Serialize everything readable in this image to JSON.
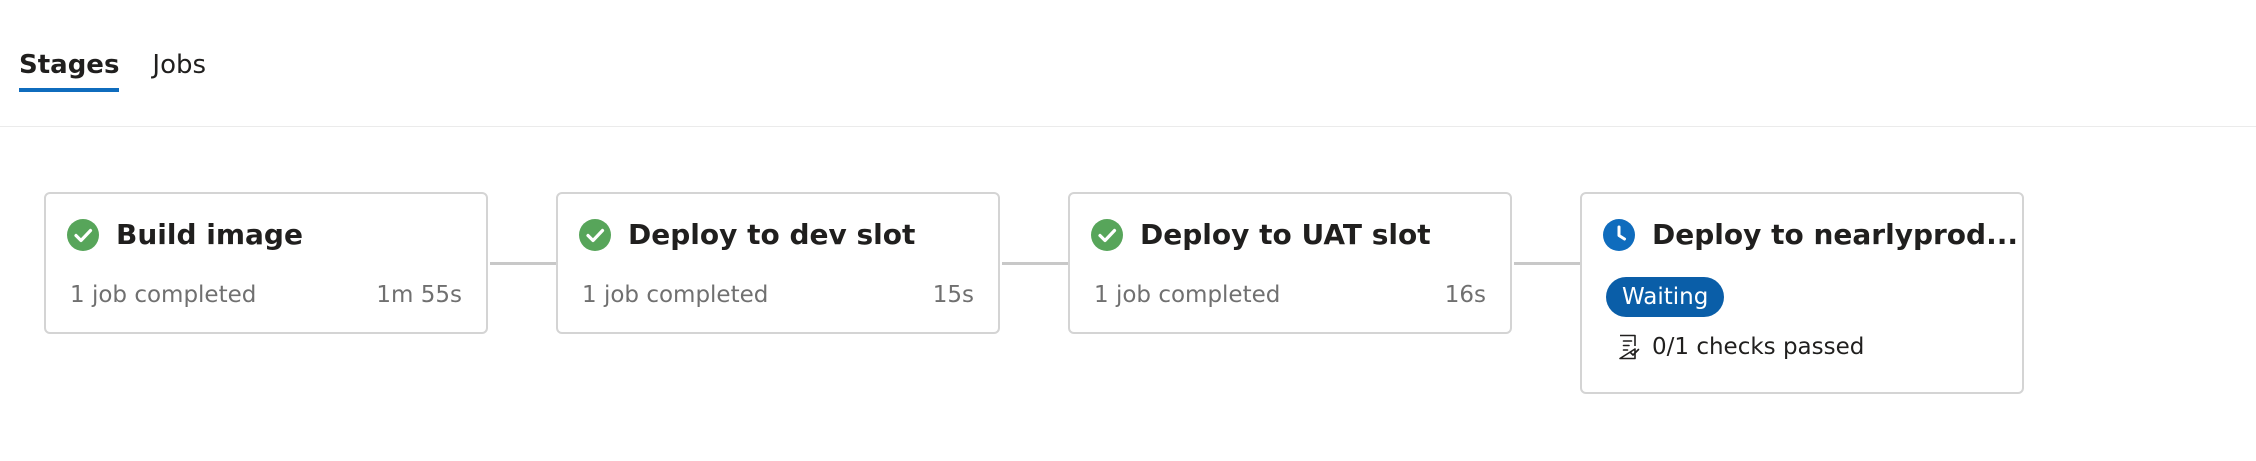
{
  "tabs": [
    {
      "label": "Stages",
      "selected": true
    },
    {
      "label": "Jobs",
      "selected": false
    }
  ],
  "colors": {
    "success": "#57a55a",
    "waiting": "#0f6cbd",
    "badge": "#0a5ea8",
    "tab_underline": "#0f6cbd"
  },
  "stages": [
    {
      "title": "Build image",
      "status_icon": "success-check-icon",
      "summary": "1 job completed",
      "duration": "1m 55s"
    },
    {
      "title": "Deploy to dev slot",
      "status_icon": "success-check-icon",
      "summary": "1 job completed",
      "duration": "15s"
    },
    {
      "title": "Deploy to UAT slot",
      "status_icon": "success-check-icon",
      "summary": "1 job completed",
      "duration": "16s"
    },
    {
      "title": "Deploy to nearlyprod...",
      "status_icon": "clock-icon",
      "badge": "Waiting",
      "checks": "0/1 checks passed",
      "checks_icon": "checklist-icon"
    }
  ]
}
